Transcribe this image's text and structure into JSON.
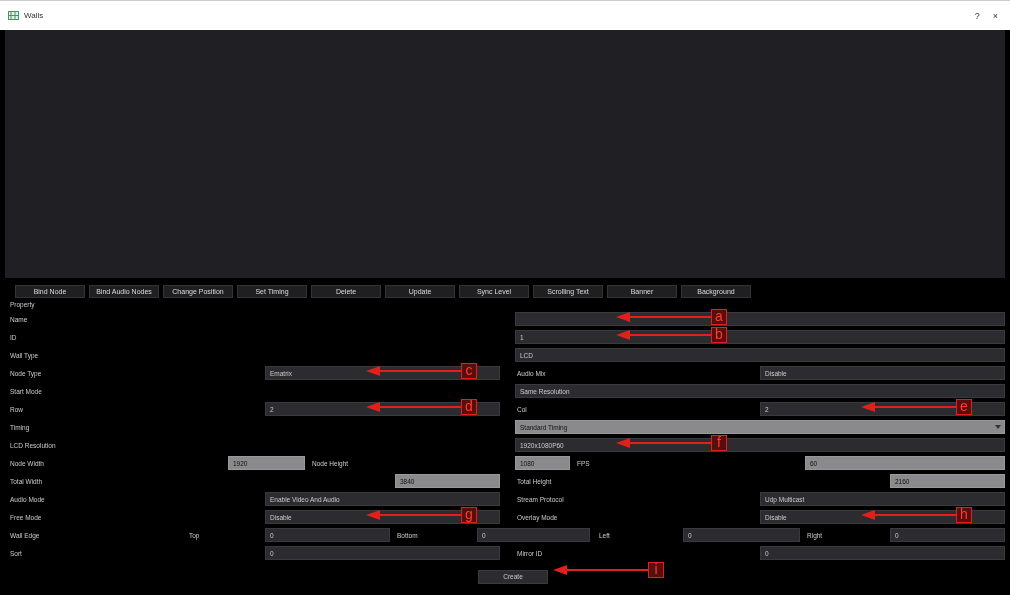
{
  "window": {
    "title": "Walls",
    "buttons": [
      "?",
      "×"
    ]
  },
  "toolbar": [
    "Bind Node",
    "Bind Audio Nodes",
    "Change Position",
    "Set Timing",
    "Delete",
    "Update",
    "Sync Level",
    "Scrolling Text",
    "Banner",
    "Background"
  ],
  "section_title": "Property",
  "rows": [
    {
      "kind": "single",
      "cells": [
        {
          "kind": "label",
          "text": "Name"
        },
        {
          "kind": "field",
          "disabled": false,
          "callout": "a"
        }
      ]
    },
    {
      "kind": "single",
      "cells": [
        {
          "kind": "label",
          "text": "ID"
        },
        {
          "kind": "field",
          "value": "1",
          "disabled": false,
          "callout": "b"
        }
      ]
    },
    {
      "kind": "single",
      "cells": [
        {
          "kind": "label",
          "text": "Wall Type"
        },
        {
          "kind": "field",
          "value": "LCD",
          "disabled": false
        }
      ]
    },
    {
      "kind": "pair",
      "cells": [
        {
          "kind": "label",
          "text": "Node Type"
        },
        {
          "kind": "field",
          "value": "Ematrix",
          "disabled": false,
          "callout": "c"
        },
        {
          "kind": "label",
          "text": "Audio Mix"
        },
        {
          "kind": "field",
          "value": "Disable",
          "disabled": false
        }
      ]
    },
    {
      "kind": "single",
      "cells": [
        {
          "kind": "label",
          "text": "Start Mode"
        },
        {
          "kind": "field",
          "value": "Same Resolution",
          "disabled": false
        }
      ]
    },
    {
      "kind": "pair",
      "cells": [
        {
          "kind": "label",
          "text": "Row"
        },
        {
          "kind": "field",
          "value": "2",
          "disabled": false,
          "callout": "d"
        },
        {
          "kind": "label",
          "text": "Col"
        },
        {
          "kind": "field",
          "value": "2",
          "disabled": false,
          "callout": "e"
        }
      ]
    },
    {
      "kind": "single",
      "cells": [
        {
          "kind": "label",
          "text": "Timing"
        },
        {
          "kind": "select",
          "value": "Standard Timing",
          "disabled": true
        }
      ]
    },
    {
      "kind": "single",
      "cells": [
        {
          "kind": "label",
          "text": "LCD Resolution"
        },
        {
          "kind": "field",
          "value": "1920x1080P60",
          "disabled": false,
          "callout": "f"
        }
      ]
    },
    {
      "kind": "sizes",
      "cells": [
        {
          "kind": "label",
          "text": "Node Width"
        },
        {
          "kind": "field",
          "value": "1920",
          "disabled": true
        },
        {
          "kind": "label",
          "text": "Node Height"
        },
        {
          "kind": "field",
          "value": "1080",
          "disabled": true
        },
        {
          "kind": "label",
          "text": "FPS"
        },
        {
          "kind": "field",
          "value": "60",
          "disabled": true
        }
      ]
    },
    {
      "kind": "totals",
      "cells": [
        {
          "kind": "label",
          "text": "Total Width"
        },
        {
          "kind": "field",
          "value": "3840",
          "disabled": true
        },
        {
          "kind": "label",
          "text": "Total Height"
        },
        {
          "kind": "field",
          "value": "2160",
          "disabled": true
        }
      ]
    },
    {
      "kind": "pair",
      "cells": [
        {
          "kind": "label",
          "text": "Audio Mode"
        },
        {
          "kind": "field",
          "value": "Enable Video And Audio",
          "disabled": false
        },
        {
          "kind": "label",
          "text": "Stream Protocol"
        },
        {
          "kind": "field",
          "value": "Udp Multicast",
          "disabled": false
        }
      ]
    },
    {
      "kind": "pair",
      "cells": [
        {
          "kind": "label",
          "text": "Free Mode"
        },
        {
          "kind": "field",
          "value": "Disable",
          "disabled": false,
          "callout": "g"
        },
        {
          "kind": "label",
          "text": "Overlay Mode"
        },
        {
          "kind": "field",
          "value": "Disable",
          "disabled": false,
          "callout": "h"
        }
      ]
    },
    {
      "kind": "edges",
      "cells": [
        {
          "kind": "label",
          "text": "Wall Edge"
        },
        {
          "kind": "label",
          "text": "Top"
        },
        {
          "kind": "field",
          "value": "0",
          "disabled": false
        },
        {
          "kind": "label",
          "text": "Bottom"
        },
        {
          "kind": "field",
          "value": "0",
          "disabled": false
        },
        {
          "kind": "label",
          "text": "Left"
        },
        {
          "kind": "field",
          "value": "0",
          "disabled": false
        },
        {
          "kind": "label",
          "text": "Right"
        },
        {
          "kind": "field",
          "value": "0",
          "disabled": false
        }
      ]
    },
    {
      "kind": "pair",
      "cells": [
        {
          "kind": "label",
          "text": "Sort"
        },
        {
          "kind": "field",
          "value": "0",
          "disabled": false
        },
        {
          "kind": "label",
          "text": "Mirror ID"
        },
        {
          "kind": "field",
          "value": "0",
          "disabled": false
        }
      ]
    }
  ],
  "create_button": {
    "label": "Create",
    "callout": "i"
  }
}
